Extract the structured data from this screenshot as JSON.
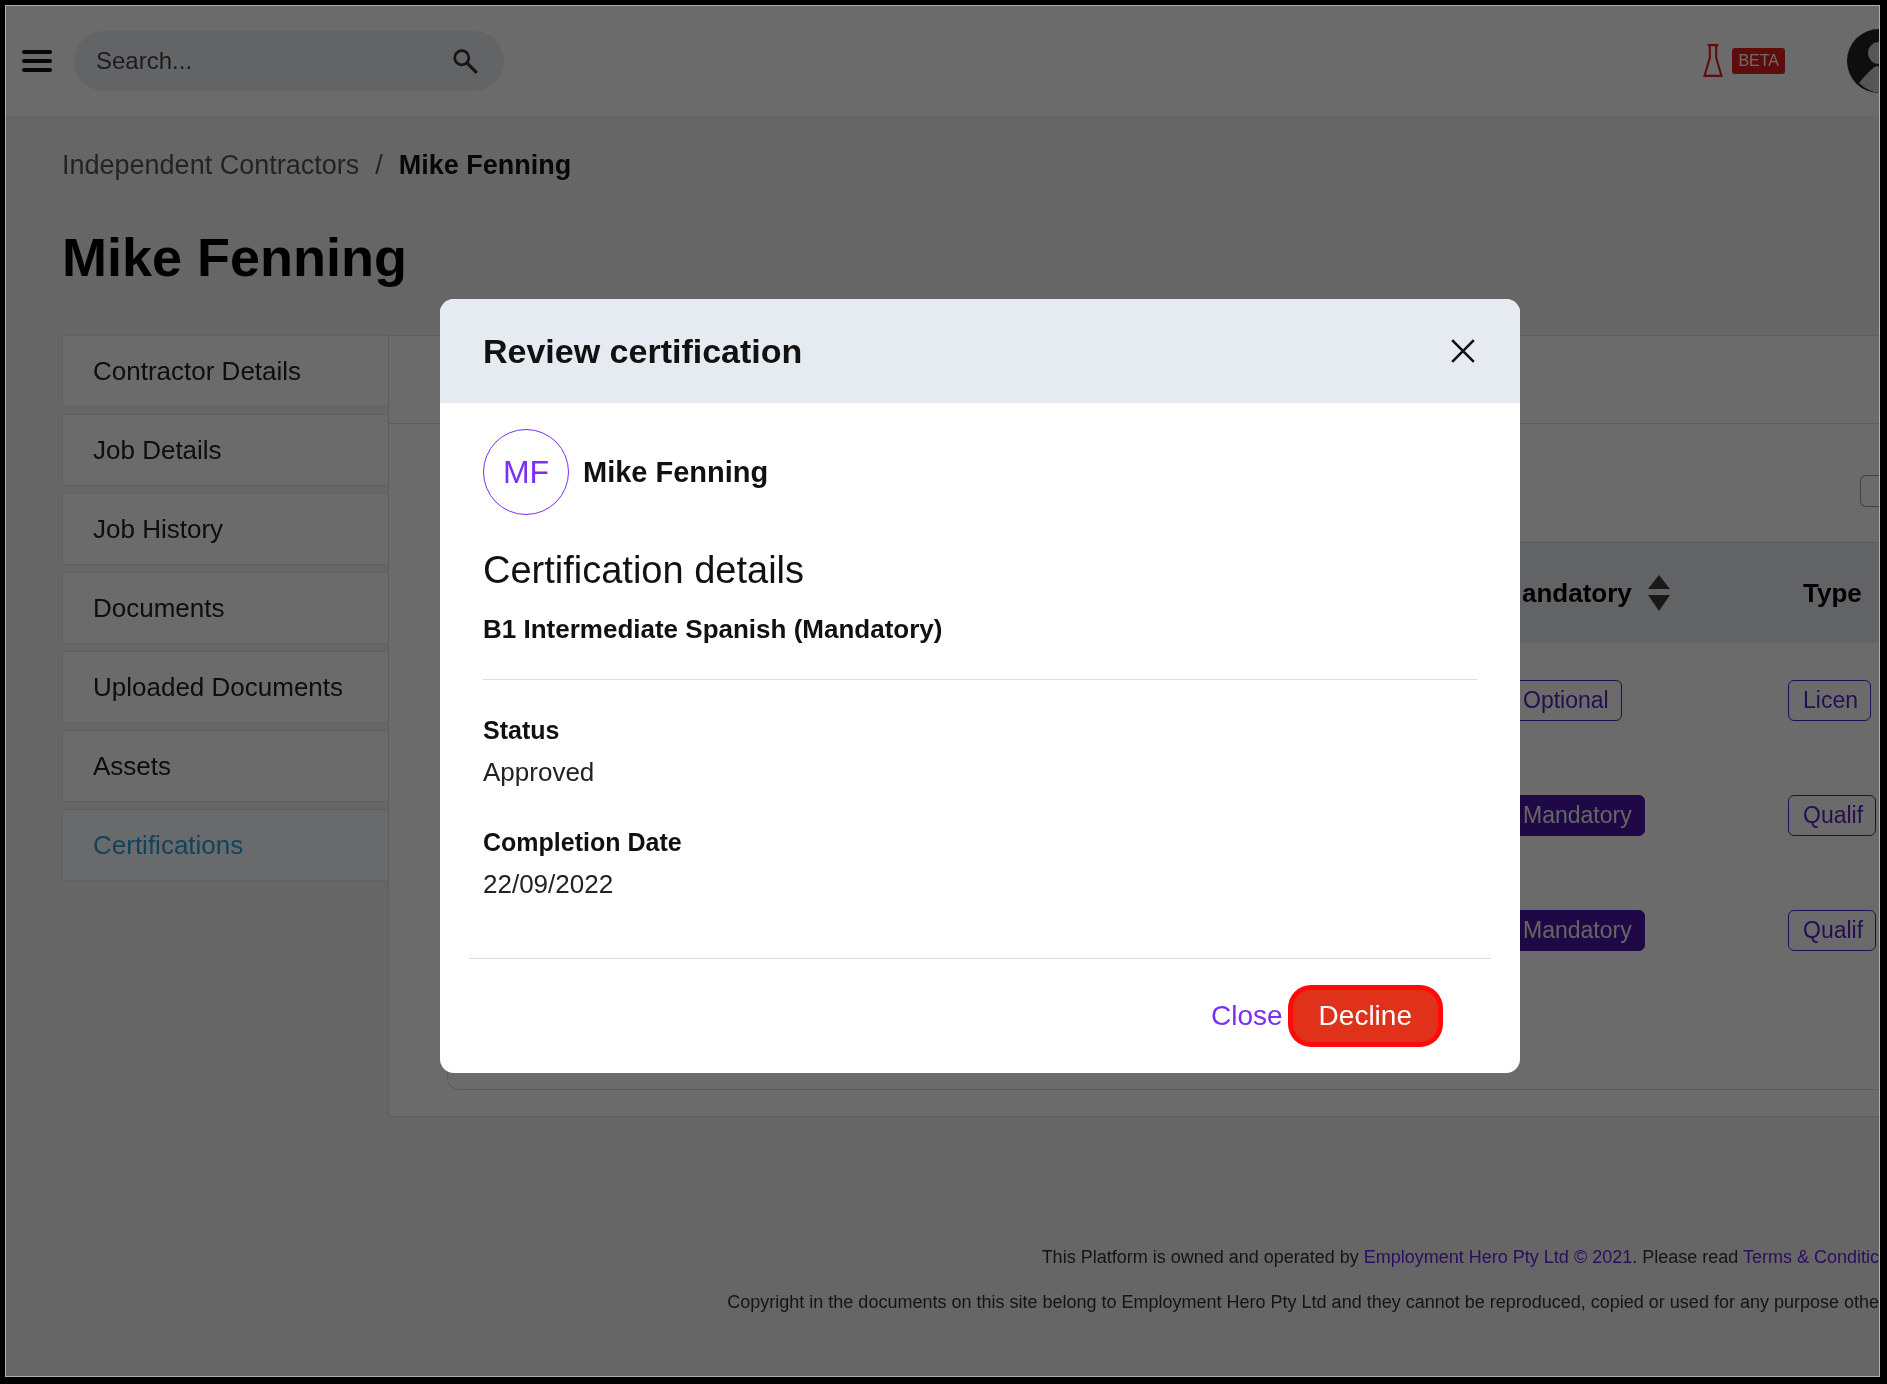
{
  "topbar": {
    "search": {
      "placeholder": "Search..."
    },
    "beta_badge": "BETA"
  },
  "breadcrumb": {
    "separator": "/",
    "items": [
      {
        "label": "Independent Contractors",
        "current": false
      },
      {
        "label": "Mike Fenning",
        "current": true
      }
    ]
  },
  "page_title": "Mike Fenning",
  "sidebar": {
    "items": [
      {
        "label": "Contractor Details",
        "selected": false
      },
      {
        "label": "Job Details",
        "selected": false
      },
      {
        "label": "Job History",
        "selected": false
      },
      {
        "label": "Documents",
        "selected": false
      },
      {
        "label": "Uploaded Documents",
        "selected": false
      },
      {
        "label": "Assets",
        "selected": false
      },
      {
        "label": "Certifications",
        "selected": true
      }
    ]
  },
  "table": {
    "columns": [
      {
        "label": "andatory",
        "sortable": true
      },
      {
        "label": "Type",
        "sortable": false
      }
    ],
    "rows": [
      {
        "mandatory": {
          "text": "Optional",
          "kind": "outline"
        },
        "type": "Licen"
      },
      {
        "mandatory": {
          "text": "Mandatory",
          "kind": "filled"
        },
        "type": "Qualif"
      },
      {
        "mandatory": {
          "text": "Mandatory",
          "kind": "filled"
        },
        "type": "Qualif"
      }
    ]
  },
  "modal": {
    "title": "Review certification",
    "person": {
      "initials": "MF",
      "name": "Mike Fenning"
    },
    "section_title": "Certification details",
    "certification": "B1 Intermediate Spanish (Mandatory)",
    "fields": [
      {
        "label": "Status",
        "value": "Approved"
      },
      {
        "label": "Completion Date",
        "value": "22/09/2022"
      }
    ],
    "buttons": [
      {
        "label": "Close",
        "kind": "link",
        "focused": false
      },
      {
        "label": "Decline",
        "kind": "danger",
        "focused": true
      }
    ]
  },
  "footer": {
    "line1": [
      {
        "text": "This Platform is owned and operated by ",
        "kind": "text"
      },
      {
        "text": "Employment Hero Pty Ltd © 2021",
        "kind": "link"
      },
      {
        "text": ". Please read ",
        "kind": "text"
      },
      {
        "text": "Terms & Conditic",
        "kind": "link"
      }
    ],
    "line2": "Copyright in the documents on this site belong to Employment Hero Pty Ltd and they cannot be reproduced, copied or used for any purpose othe"
  }
}
